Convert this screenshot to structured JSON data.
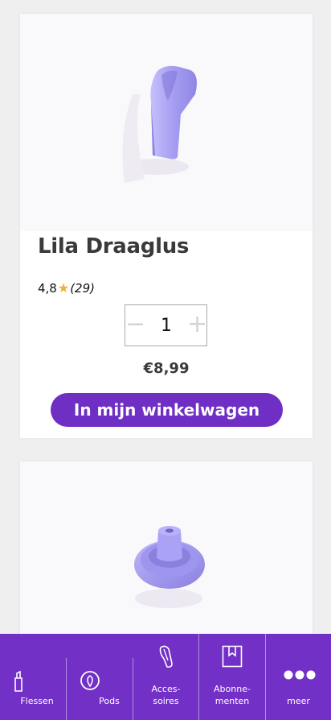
{
  "products": [
    {
      "title": "Lila Draaglus",
      "rating": "4,8",
      "review_count": "(29)",
      "quantity": "1",
      "price": "€8,99",
      "cart_label": "In mijn winkelwagen",
      "icons": [
        "star-icon",
        "minus-icon",
        "plus-icon"
      ]
    },
    {
      "image": "purple-bottle-cap"
    }
  ],
  "bottom_nav": {
    "items": [
      {
        "label": "Flessen",
        "icon": "bottle-icon"
      },
      {
        "label": "Pods",
        "icon": "pod-icon"
      },
      {
        "label": "Acces-\nsoires",
        "icon": "strap-icon"
      },
      {
        "label": "Abonne-\nmenten",
        "icon": "bookmark-icon"
      },
      {
        "label": "meer",
        "icon": "more-dots-icon"
      }
    ]
  },
  "colors": {
    "accent": "#6f2ec4",
    "nav_background": "#7230c6",
    "product_lilac": "#a39bf0",
    "star": "#f2b12c",
    "title": "#3a3a3a"
  }
}
